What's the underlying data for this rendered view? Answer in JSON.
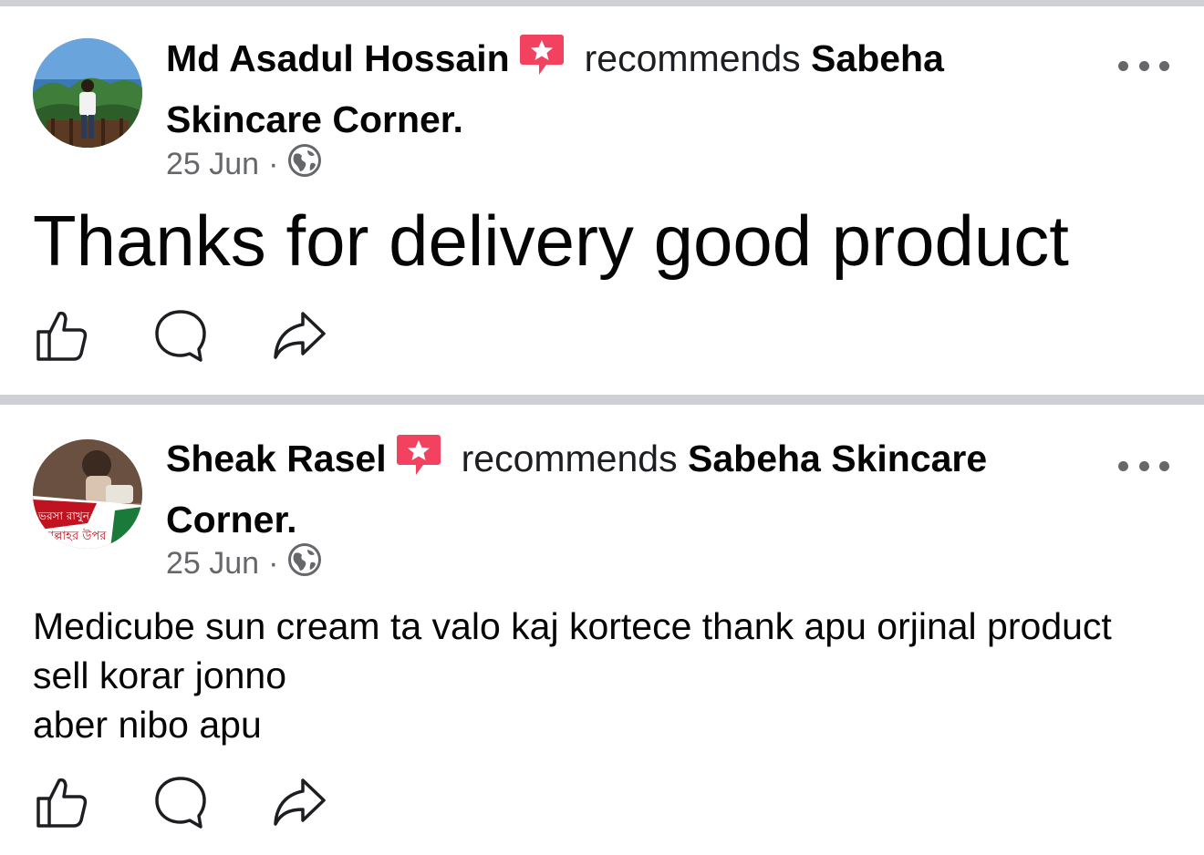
{
  "posts": [
    {
      "author": "Md Asadul Hossain",
      "recommends": "recommends",
      "page_name": "Sabeha Skincare Corner.",
      "date": "25 Jun",
      "separator": "·",
      "text": "Thanks for delivery good product"
    },
    {
      "author": "Sheak Rasel",
      "recommends": "recommends",
      "page_name": "Sabeha Skincare Corner.",
      "date": "25 Jun",
      "separator": "·",
      "text": "Medicube sun cream ta valo kaj kortece thank apu orjinal product sell korar jonno\naber nibo apu"
    }
  ],
  "icons": {
    "recommend_badge": "recommend-star-icon",
    "privacy": "globe-icon",
    "more": "more-options-icon",
    "like": "like-icon",
    "comment": "comment-icon",
    "share": "share-icon"
  },
  "colors": {
    "badge": "#f3425f",
    "secondary_text": "#65676b",
    "divider": "#cfd0d5"
  }
}
